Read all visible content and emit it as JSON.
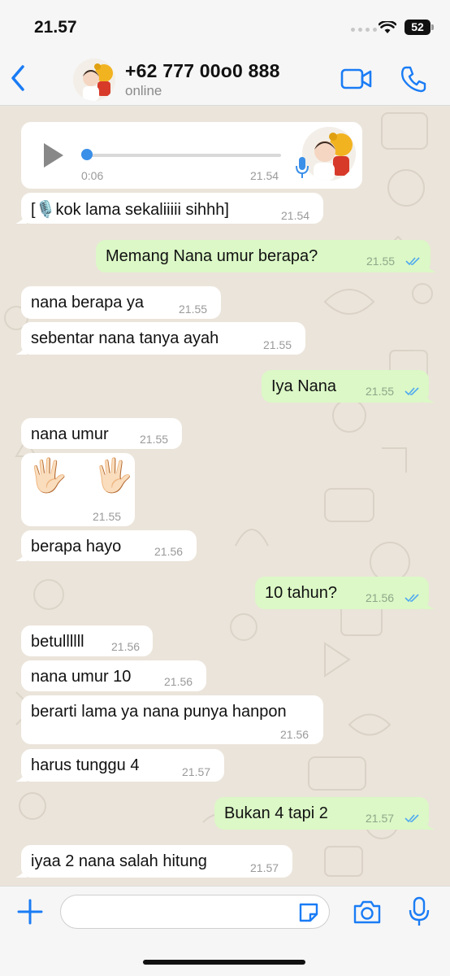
{
  "status_bar": {
    "time": "21.57",
    "battery": "52",
    "icons": [
      "signal-dots-icon",
      "wifi-icon",
      "battery-icon"
    ]
  },
  "header": {
    "back_icon": "chevron-left-icon",
    "contact_name": "+62 777 00o0 888",
    "contact_status": "online",
    "video_icon": "video-call-icon",
    "phone_icon": "phone-icon"
  },
  "colors": {
    "accent": "#1a7cf5",
    "incoming_bubble": "#ffffff",
    "outgoing_bubble": "#dbf8c6",
    "chat_background": "#ebe4da",
    "read_ticks": "#4fa8f0"
  },
  "voice_note": {
    "duration": "0:06",
    "time": "21.54",
    "progress": 0.0
  },
  "messages": [
    {
      "dir": "in",
      "text": "[🎙️kok lama sekaliiiii sihhh]",
      "time": "21.54"
    },
    {
      "dir": "out",
      "text": "Memang Nana umur berapa?",
      "time": "21.55",
      "read": true
    },
    {
      "dir": "in",
      "text": "nana berapa ya",
      "time": "21.55"
    },
    {
      "dir": "in",
      "text": "sebentar nana tanya ayah",
      "time": "21.55"
    },
    {
      "dir": "out",
      "text": "Iya Nana",
      "time": "21.55",
      "read": true
    },
    {
      "dir": "in",
      "text": "nana umur",
      "time": "21.55"
    },
    {
      "dir": "in",
      "text": "🖐🏻 🖐🏻",
      "time": "21.55"
    },
    {
      "dir": "in",
      "text": "berapa hayo",
      "time": "21.56"
    },
    {
      "dir": "out",
      "text": "10 tahun?",
      "time": "21.56",
      "read": true
    },
    {
      "dir": "in",
      "text": "betullllll",
      "time": "21.56"
    },
    {
      "dir": "in",
      "text": "nana umur 10",
      "time": "21.56"
    },
    {
      "dir": "in",
      "text": "berarti lama ya nana punya hanpon",
      "time": "21.56"
    },
    {
      "dir": "in",
      "text": "harus tunggu 4",
      "time": "21.57"
    },
    {
      "dir": "out",
      "text": "Bukan 4 tapi 2",
      "time": "21.57",
      "read": true
    },
    {
      "dir": "in",
      "text": "iyaa 2 nana salah hitung",
      "time": "21.57"
    }
  ],
  "input_bar": {
    "placeholder": "",
    "plus_icon": "plus-icon",
    "sticker_icon": "sticker-icon",
    "camera_icon": "camera-icon",
    "mic_icon": "microphone-icon"
  }
}
